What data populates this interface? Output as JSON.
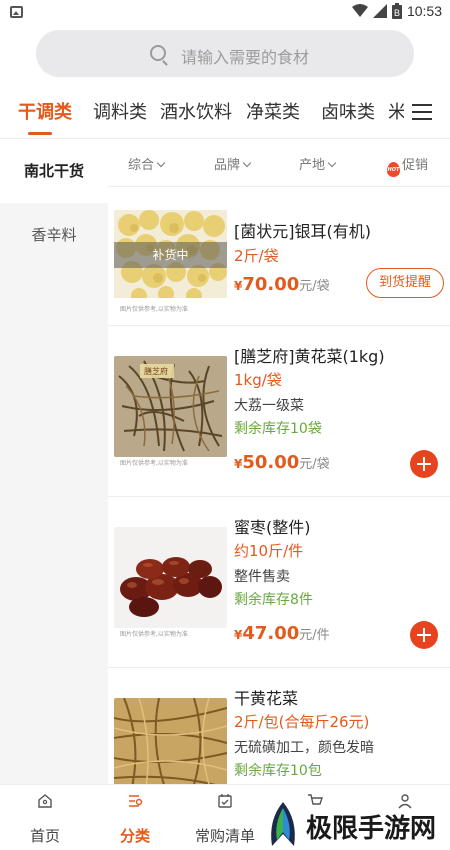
{
  "status_bar": {
    "time": "10:53",
    "battery_level": "B"
  },
  "search": {
    "placeholder": "请输入需要的食材"
  },
  "category_tabs": [
    {
      "label": "干调类",
      "active": true
    },
    {
      "label": "调料类",
      "active": false
    },
    {
      "label": "酒水饮料",
      "active": false
    },
    {
      "label": "净菜类",
      "active": false
    },
    {
      "label": "卤味类",
      "active": false
    },
    {
      "label": "米",
      "active": false
    }
  ],
  "sidebar": {
    "items": [
      {
        "label": "南北干货",
        "active": true
      },
      {
        "label": "香辛料",
        "active": false
      }
    ]
  },
  "filters": {
    "sort": "综合",
    "brand": "品牌",
    "origin": "产地",
    "promo": "促销",
    "hot_badge": "HOT"
  },
  "products": [
    {
      "name": "[菌状元]银耳(有机)",
      "spec": "2斤/袋",
      "price": "70.00",
      "currency": "¥",
      "unit": "元/袋",
      "image_note": "图片仅供参考,以实物为准",
      "status_overlay": "补货中",
      "action_label": "到货提醒"
    },
    {
      "name": "[膳芝府]黄花菜(1kg)",
      "spec": "1kg/袋",
      "desc": "大荔一级菜",
      "stock": "剩余库存10袋",
      "price": "50.00",
      "currency": "¥",
      "unit": "元/袋",
      "image_note": "图片仅供参考,以实物为准",
      "package_label": "膳芝府"
    },
    {
      "name": "蜜枣(整件)",
      "spec": "约10斤/件",
      "desc": "整件售卖",
      "stock": "剩余库存8件",
      "price": "47.00",
      "currency": "¥",
      "unit": "元/件",
      "image_note": "图片仅供参考,以实物为准"
    },
    {
      "name": "干黄花菜",
      "spec": "2斤/包(合每斤26元)",
      "desc": "无硫磺加工，颜色发暗",
      "stock": "剩余库存10包"
    }
  ],
  "bottom_nav": [
    {
      "label": "首页",
      "icon": "home-icon",
      "active": false
    },
    {
      "label": "分类",
      "icon": "category-icon",
      "active": true
    },
    {
      "label": "常购清单",
      "icon": "checklist-icon",
      "active": false
    },
    {
      "label": "",
      "icon": "cart-icon",
      "active": false
    },
    {
      "label": "",
      "icon": "user-icon",
      "active": false
    }
  ],
  "watermark": {
    "text": "极限手游网"
  },
  "colors": {
    "accent": "#e35a1d",
    "stock_green": "#6aa83f",
    "add_button": "#e8431f"
  }
}
